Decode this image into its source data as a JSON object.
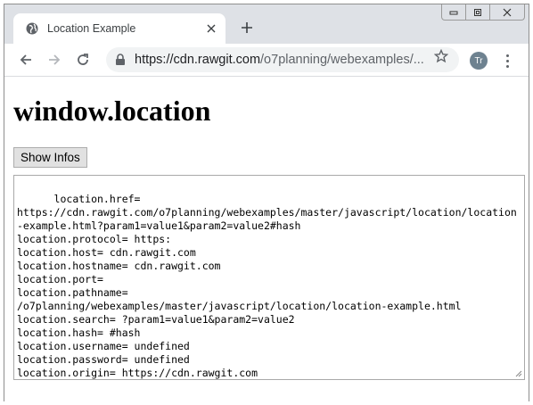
{
  "window": {
    "tab_title": "Location Example",
    "url_domain": "https://cdn.rawgit.com",
    "url_rest": "/o7planning/webexamples/...",
    "profile_initials": "Tr"
  },
  "page": {
    "heading": "window.location",
    "button_label": "Show Infos",
    "output_text": "location.href=\nhttps://cdn.rawgit.com/o7planning/webexamples/master/javascript/location/location-example.html?param1=value1&param2=value2#hash\nlocation.protocol= https:\nlocation.host= cdn.rawgit.com\nlocation.hostname= cdn.rawgit.com\nlocation.port=\nlocation.pathname=\n/o7planning/webexamples/master/javascript/location/location-example.html\nlocation.search= ?param1=value1&param2=value2\nlocation.hash= #hash\nlocation.username= undefined\nlocation.password= undefined\nlocation.origin= https://cdn.rawgit.com"
  },
  "icons": [
    "globe-icon",
    "close-icon",
    "plus-icon",
    "back-icon",
    "forward-icon",
    "reload-icon",
    "lock-icon",
    "star-icon",
    "menu-icon",
    "minimize-icon",
    "restore-icon",
    "window-close-icon"
  ],
  "colors": {
    "titlebar": "#dee1e6",
    "omnibox": "#f1f3f4",
    "avatar": "#6e8290"
  }
}
